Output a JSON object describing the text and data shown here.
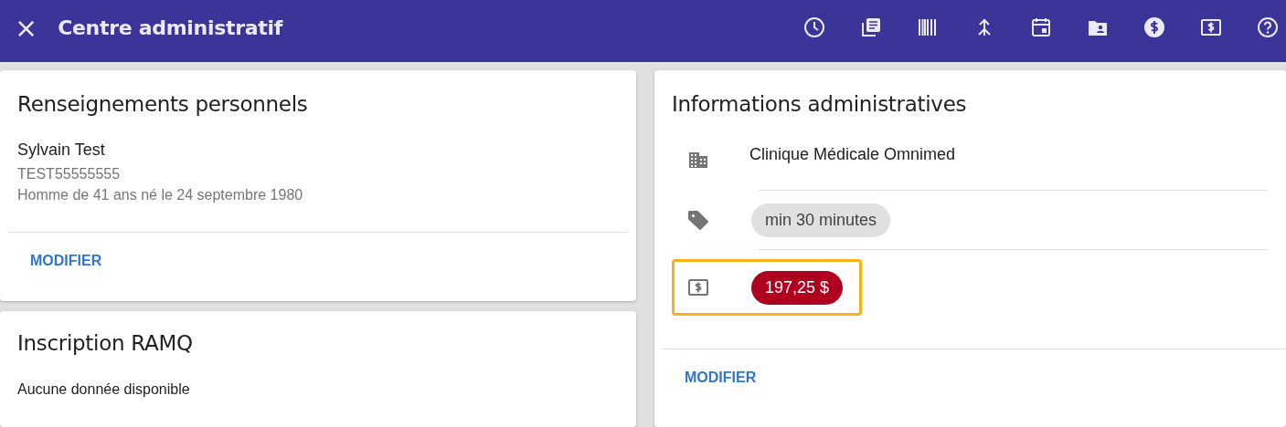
{
  "app_bar": {
    "close_label": "×",
    "title": "Centre administratif",
    "actions": [
      {
        "kind": "clock"
      },
      {
        "kind": "library"
      },
      {
        "kind": "barcode"
      },
      {
        "kind": "merge"
      },
      {
        "kind": "calendar"
      },
      {
        "kind": "folder-person"
      },
      {
        "kind": "dollar-circle"
      },
      {
        "kind": "money"
      },
      {
        "kind": "help"
      }
    ]
  },
  "personal": {
    "title": "Renseignements personnels",
    "name": "Sylvain Test",
    "file_number": "TEST55555555",
    "description": "Homme de 41 ans né le 24 septembre 1980",
    "action": "MODIFIER"
  },
  "ramq": {
    "title": "Inscription RAMQ",
    "message": "Aucune donnée disponible"
  },
  "administrative": {
    "title": "Informations administratives",
    "rows": [
      {
        "kind": "building",
        "text": "Clinique Médicale Omnimed",
        "highlighted": false
      },
      {
        "kind": "tag",
        "chip": "min 30 minutes",
        "color": "#e0e0e0",
        "highlighted": false
      },
      {
        "kind": "money",
        "chip": "197,25 $",
        "color": "#b00020",
        "highlighted": true
      }
    ],
    "action": "MODIFIER"
  }
}
